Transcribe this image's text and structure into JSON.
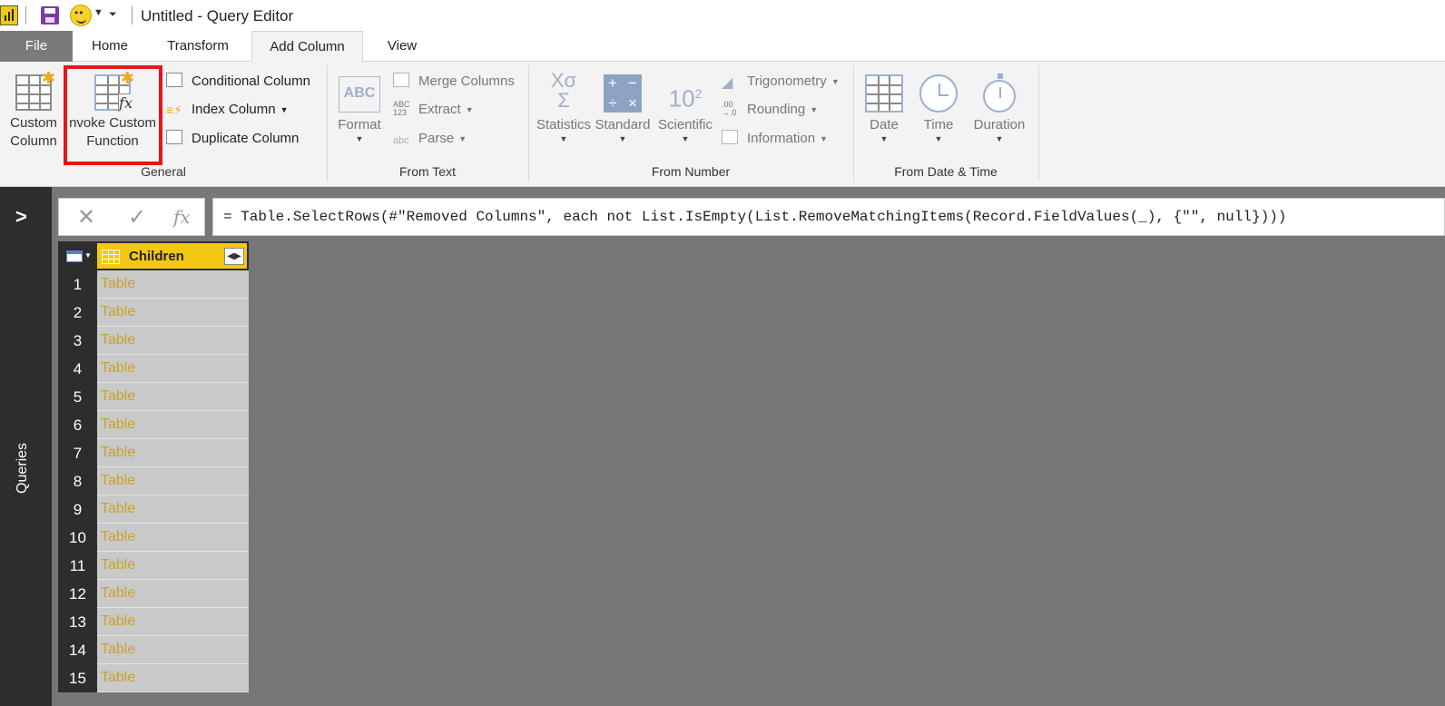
{
  "window": {
    "title": "Untitled - Query Editor"
  },
  "tabs": [
    {
      "label": "File"
    },
    {
      "label": "Home"
    },
    {
      "label": "Transform"
    },
    {
      "label": "Add Column",
      "active": true
    },
    {
      "label": "View"
    }
  ],
  "ribbon": {
    "general": {
      "label": "General",
      "custom_column": [
        "Custom",
        "Column"
      ],
      "invoke_custom_function": [
        "nvoke Custom",
        "Function"
      ],
      "conditional_column": "Conditional Column",
      "index_column": "Index Column",
      "duplicate_column": "Duplicate Column"
    },
    "from_text": {
      "label": "From Text",
      "format": "Format",
      "merge_columns": "Merge Columns",
      "extract": "Extract",
      "parse": "Parse"
    },
    "from_number": {
      "label": "From Number",
      "statistics": "Statistics",
      "standard": "Standard",
      "scientific": "Scientific",
      "trigonometry": "Trigonometry",
      "rounding": "Rounding",
      "information": "Information"
    },
    "from_date_time": {
      "label": "From Date & Time",
      "date": "Date",
      "time": "Time",
      "duration": "Duration"
    }
  },
  "queries_pane": {
    "label": "Queries"
  },
  "formula_bar": {
    "formula": "= Table.SelectRows(#\"Removed Columns\", each not List.IsEmpty(List.RemoveMatchingItems(Record.FieldValues(_), {\"\", null})))"
  },
  "grid": {
    "column_header": "Children",
    "rows": [
      {
        "num": "1",
        "value": "Table"
      },
      {
        "num": "2",
        "value": "Table"
      },
      {
        "num": "3",
        "value": "Table"
      },
      {
        "num": "4",
        "value": "Table"
      },
      {
        "num": "5",
        "value": "Table"
      },
      {
        "num": "6",
        "value": "Table"
      },
      {
        "num": "7",
        "value": "Table"
      },
      {
        "num": "8",
        "value": "Table"
      },
      {
        "num": "9",
        "value": "Table"
      },
      {
        "num": "10",
        "value": "Table"
      },
      {
        "num": "11",
        "value": "Table"
      },
      {
        "num": "12",
        "value": "Table"
      },
      {
        "num": "13",
        "value": "Table"
      },
      {
        "num": "14",
        "value": "Table"
      },
      {
        "num": "15",
        "value": "Table"
      }
    ]
  },
  "colors": {
    "highlight_box": "#e8141b",
    "column_header": "#f2c811",
    "cell_text": "#c9a227",
    "pane_dark": "#2d2d2d",
    "canvas": "#777777"
  }
}
